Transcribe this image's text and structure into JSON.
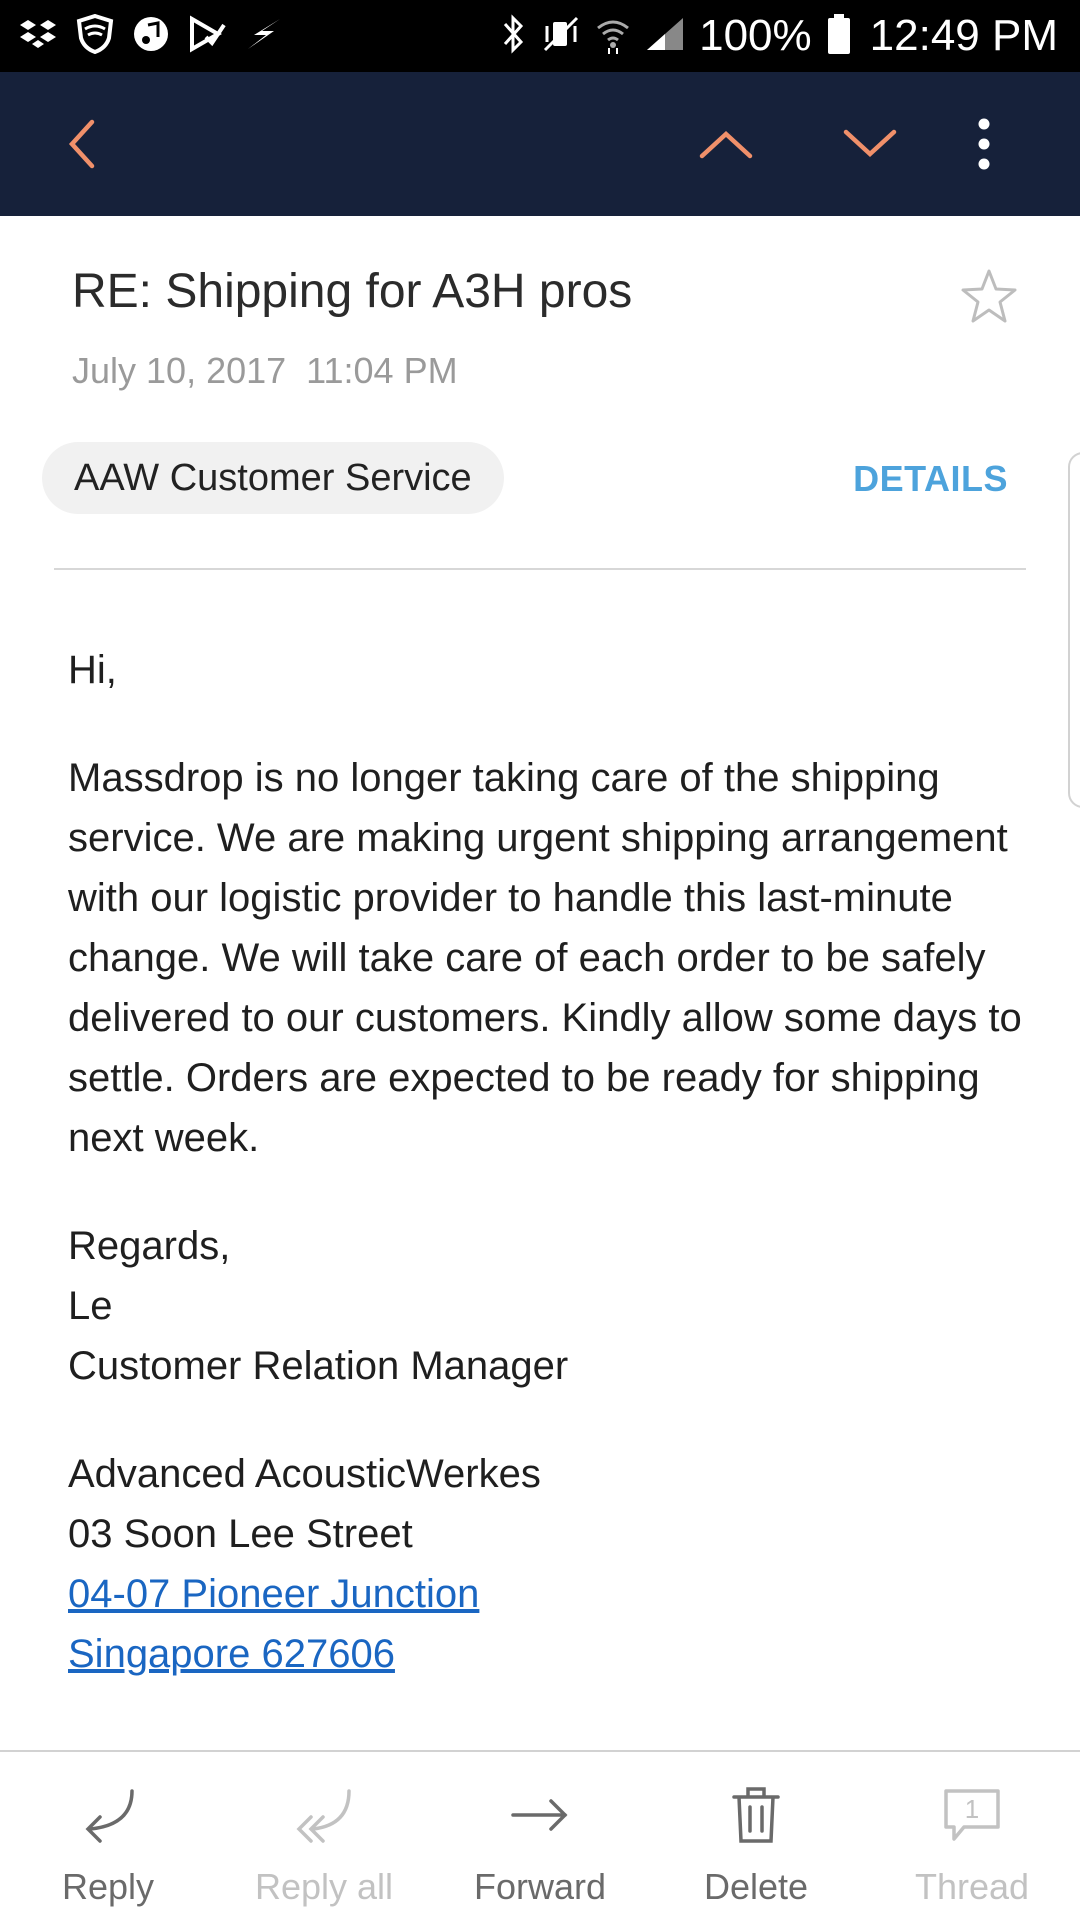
{
  "status_bar": {
    "battery": "100%",
    "time": "12:49 PM"
  },
  "app_bar": {
    "back_icon": "chevron-left-icon",
    "prev_icon": "chevron-up-icon",
    "next_icon": "chevron-down-icon",
    "more_icon": "more-vert-icon",
    "accent_color": "#f0906a",
    "background": "#16213a"
  },
  "email": {
    "subject": "RE: Shipping for A3H pros",
    "date": "July 10, 2017",
    "time": "11:04 PM",
    "sender": "AAW Customer Service",
    "details_label": "DETAILS",
    "greeting": "Hi,",
    "paragraph": "Massdrop is no longer taking care of the shipping service. We are making urgent shipping arrangement with our logistic provider to handle this last-minute change. We will take care of each order to be safely delivered to our customers. Kindly allow some days to settle. Orders are expected to be ready for shipping next week.",
    "signature": {
      "regards": "Regards,",
      "name": "Le",
      "title": "Customer Relation Manager"
    },
    "address": {
      "company": "Advanced AcousticWerkes",
      "street": "03 Soon Lee Street",
      "unit_link": "04-07 Pioneer Junction",
      "city_link": "Singapore 627606"
    }
  },
  "toolbar": {
    "reply": "Reply",
    "reply_all": "Reply all",
    "forward": "Forward",
    "delete": "Delete",
    "thread": "Thread",
    "thread_count": "1"
  }
}
